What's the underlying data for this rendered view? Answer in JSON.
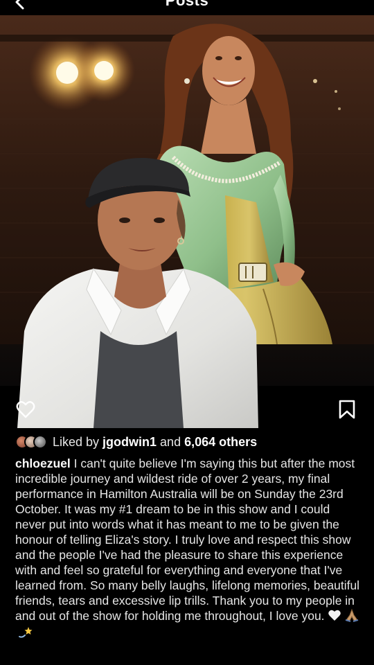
{
  "header": {
    "title": "Posts",
    "back_icon": "chevron-left-icon"
  },
  "post": {
    "image_description_icons": {
      "like": "heart-outline-icon",
      "save": "bookmark-outline-icon"
    },
    "likes": {
      "prefix": "Liked by ",
      "user": "jgodwin1",
      "middle": " and ",
      "others": "6,064 others"
    },
    "caption": {
      "username": "chloezuel",
      "text": " I can't quite believe I'm saying this but after the most incredible journey and wildest ride of over 2 years, my final performance in Hamilton Australia will be on Sunday the 23rd October. It was my #1 dream to be in this show and I could never put into words what it has meant to me to be given the honour of telling Eliza's story. I truly love and respect this show and the people I've had the pleasure to share this experience with and feel so grateful for everything and everyone that I've learned from. So many belly laughs, lifelong memories, beautiful friends, tears and excessive lip trills. Thank you to my people in and out of the show for holding me throughout, I love you.",
      "emojis": [
        "white-heart-icon",
        "praying-hands-icon",
        "dizzy-star-icon"
      ]
    }
  },
  "colors": {
    "background": "#000000",
    "text": "#ffffff",
    "dress": "#9cc79a",
    "stage": "#2d1810"
  }
}
